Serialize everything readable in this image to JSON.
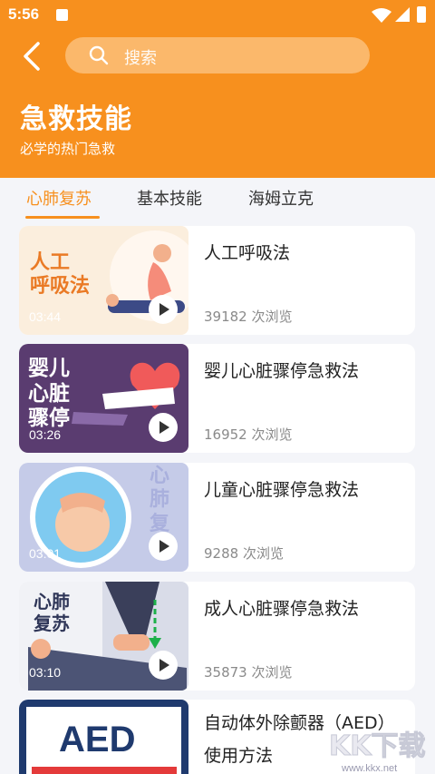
{
  "status_bar": {
    "time": "5:56"
  },
  "search": {
    "placeholder": "搜索"
  },
  "header": {
    "title": "急救技能",
    "subtitle": "必学的热门急救"
  },
  "tabs": [
    {
      "label": "心肺复苏",
      "active": true
    },
    {
      "label": "基本技能",
      "active": false
    },
    {
      "label": "海姆立克",
      "active": false
    }
  ],
  "cards": [
    {
      "title": "人工呼吸法",
      "views": "39182 次浏览",
      "duration": "03:44",
      "cover_text": "人工\n呼吸法"
    },
    {
      "title": "婴儿心脏骤停急救法",
      "views": "16952 次浏览",
      "duration": "03:26",
      "cover_text": "婴儿\n心脏\n骤停"
    },
    {
      "title": "儿童心脏骤停急救法",
      "views": "9288 次浏览",
      "duration": "03:01",
      "cover_text": "心肺复苏"
    },
    {
      "title": "成人心脏骤停急救法",
      "views": "35873 次浏览",
      "duration": "03:10",
      "cover_text": "心肺\n复苏"
    },
    {
      "title": "自动体外除颤器（AED）使用方法",
      "views": "",
      "duration": "",
      "cover_text": "AED"
    }
  ],
  "watermark": {
    "text": "KK下载",
    "url": "www.kkx.net"
  },
  "colors": {
    "accent": "#f7901e",
    "background": "#f4f5f9"
  }
}
